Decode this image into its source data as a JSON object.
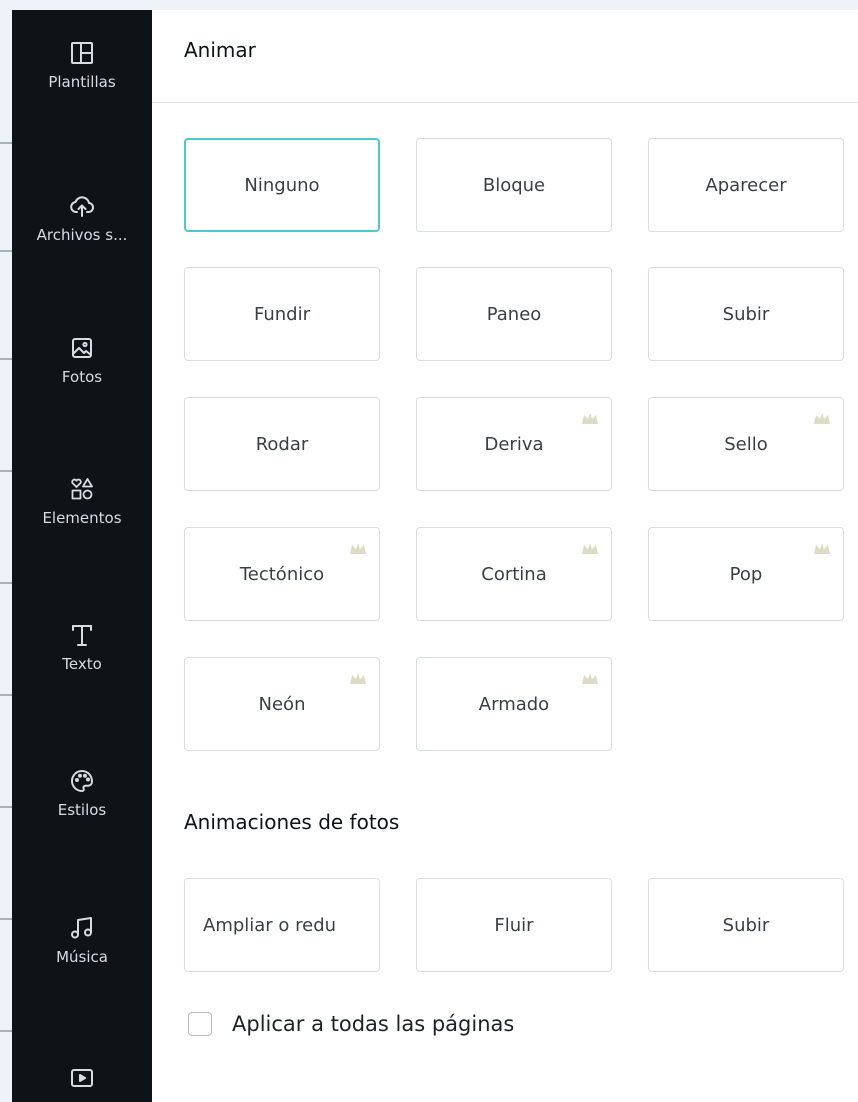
{
  "sidebar": {
    "items": [
      {
        "label": "Plantillas",
        "icon": "layout-icon"
      },
      {
        "label": "Archivos s...",
        "icon": "cloud-upload-icon"
      },
      {
        "label": "Fotos",
        "icon": "image-icon"
      },
      {
        "label": "Elementos",
        "icon": "shapes-icon"
      },
      {
        "label": "Texto",
        "icon": "text-icon"
      },
      {
        "label": "Estilos",
        "icon": "palette-icon"
      },
      {
        "label": "Música",
        "icon": "music-icon"
      },
      {
        "label": "",
        "icon": "video-icon"
      }
    ]
  },
  "panel": {
    "title": "Animar",
    "animations": [
      {
        "label": "Ninguno",
        "premium": false,
        "selected": true
      },
      {
        "label": "Bloque",
        "premium": false
      },
      {
        "label": "Aparecer",
        "premium": false
      },
      {
        "label": "Fundir",
        "premium": false
      },
      {
        "label": "Paneo",
        "premium": false
      },
      {
        "label": "Subir",
        "premium": false
      },
      {
        "label": "Rodar",
        "premium": false
      },
      {
        "label": "Deriva",
        "premium": true
      },
      {
        "label": "Sello",
        "premium": true
      },
      {
        "label": "Tectónico",
        "premium": true
      },
      {
        "label": "Cortina",
        "premium": true
      },
      {
        "label": "Pop",
        "premium": true
      },
      {
        "label": "Neón",
        "premium": true
      },
      {
        "label": "Armado",
        "premium": true
      }
    ],
    "photo_section_title": "Animaciones de fotos",
    "photo_animations": [
      {
        "label": "Ampliar o redu"
      },
      {
        "label": "Fluir"
      },
      {
        "label": "Subir"
      }
    ],
    "apply_all_label": "Aplicar a todas las páginas",
    "apply_all_checked": false
  },
  "colors": {
    "sidebar_bg": "#0e1318",
    "selected_border": "#4fc8cc",
    "crown": "#d6d6b6"
  }
}
